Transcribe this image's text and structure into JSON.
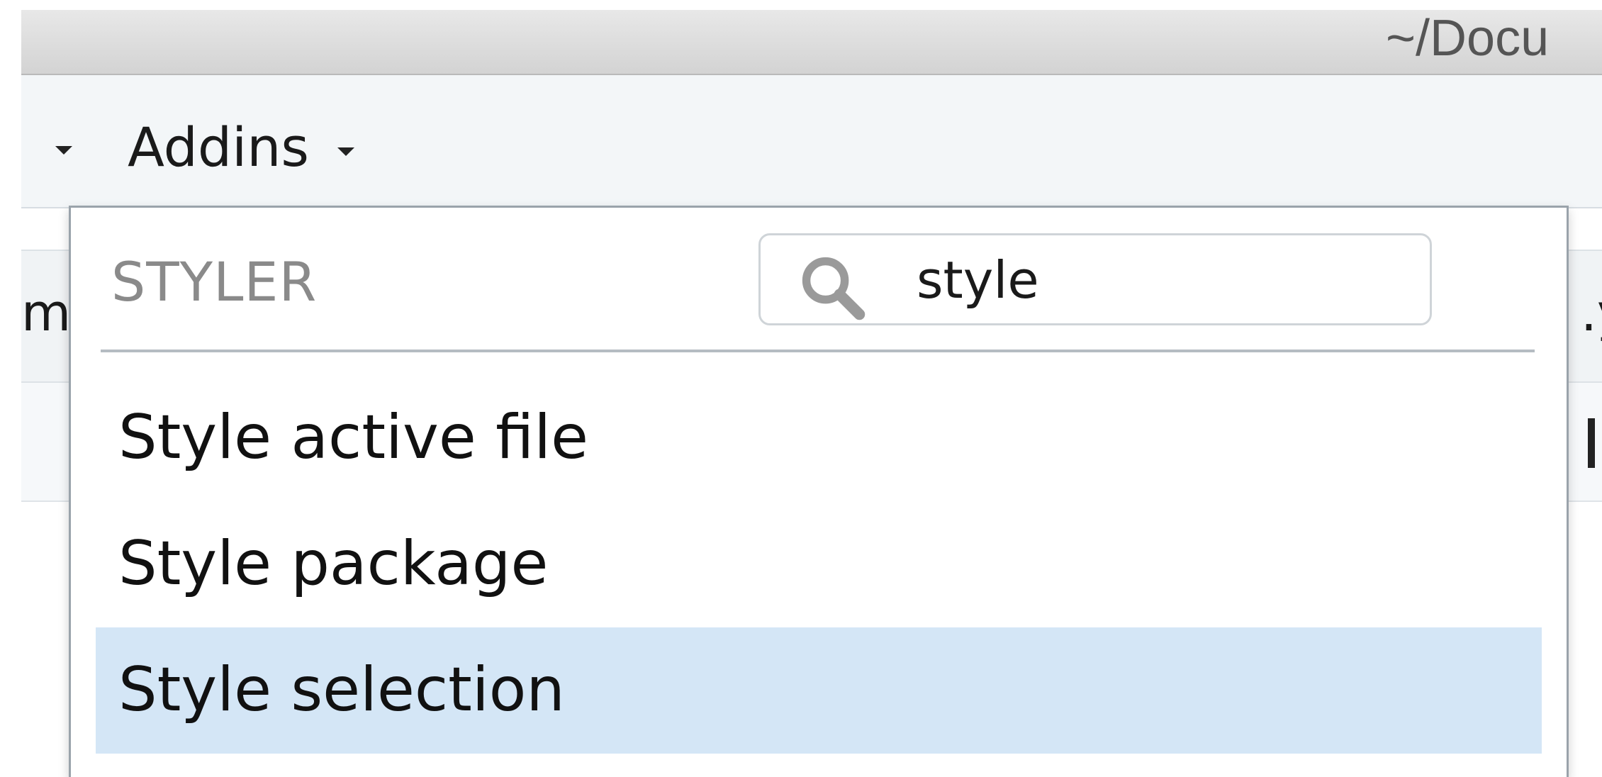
{
  "window": {
    "title": "~/Docu"
  },
  "toolbar": {
    "addins_label": "Addins"
  },
  "background_tabs": {
    "left_fragment": "m",
    "right_fragment": ".y"
  },
  "dropdown": {
    "group_header": "STYLER",
    "search": {
      "value": "style",
      "icon": "search-icon"
    },
    "items": [
      {
        "label": "Style active file"
      },
      {
        "label": "Style package"
      },
      {
        "label": "Style selection",
        "highlighted": true
      }
    ],
    "highlight_color": "#d4e6f6"
  }
}
